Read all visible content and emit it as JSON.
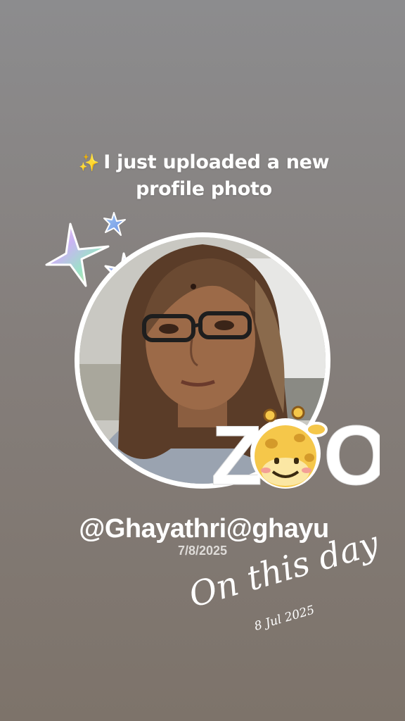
{
  "story": {
    "headline_icon": "✨",
    "headline": "I just uploaded a new profile photo",
    "handle": "@Ghayathri@ghayu",
    "date": "7/8/2025",
    "sticker_title": "On this day",
    "sticker_date": "8 Jul 2025",
    "zoo_letters": {
      "z": "Z",
      "o": "O"
    },
    "icons": [
      "sparkle-icon",
      "star-icon",
      "giraffe-icon"
    ]
  }
}
